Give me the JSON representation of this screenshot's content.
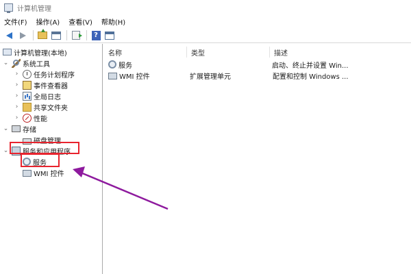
{
  "window": {
    "title": "计算机管理"
  },
  "menu": [
    "文件(F)",
    "操作(A)",
    "查看(V)",
    "帮助(H)"
  ],
  "toolbar": {
    "help_label": "?"
  },
  "tree": {
    "root": "计算机管理(本地)",
    "system_tools": "系统工具",
    "task_scheduler": "任务计划程序",
    "event_viewer": "事件查看器",
    "perf_logs": "全局日志",
    "shared_folders": "共享文件夹",
    "performance": "性能",
    "storage": "存储",
    "disk_management": "磁盘管理",
    "services_apps": "服务和应用程序",
    "services": "服务",
    "wmi": "WMI 控件",
    "expanded_glyph": "⌄",
    "collapsed_glyph": "›"
  },
  "list": {
    "columns": [
      "名称",
      "类型",
      "描述"
    ],
    "rows": [
      {
        "name": "服务",
        "type": "",
        "desc": "启动、终止并设置 Win..."
      },
      {
        "name": "WMI 控件",
        "type": "扩展管理单元",
        "desc": "配置和控制 Windows ..."
      }
    ]
  },
  "annotations": {
    "highlight_color": "#e8232d",
    "arrow_color": "#8e1a9e"
  }
}
